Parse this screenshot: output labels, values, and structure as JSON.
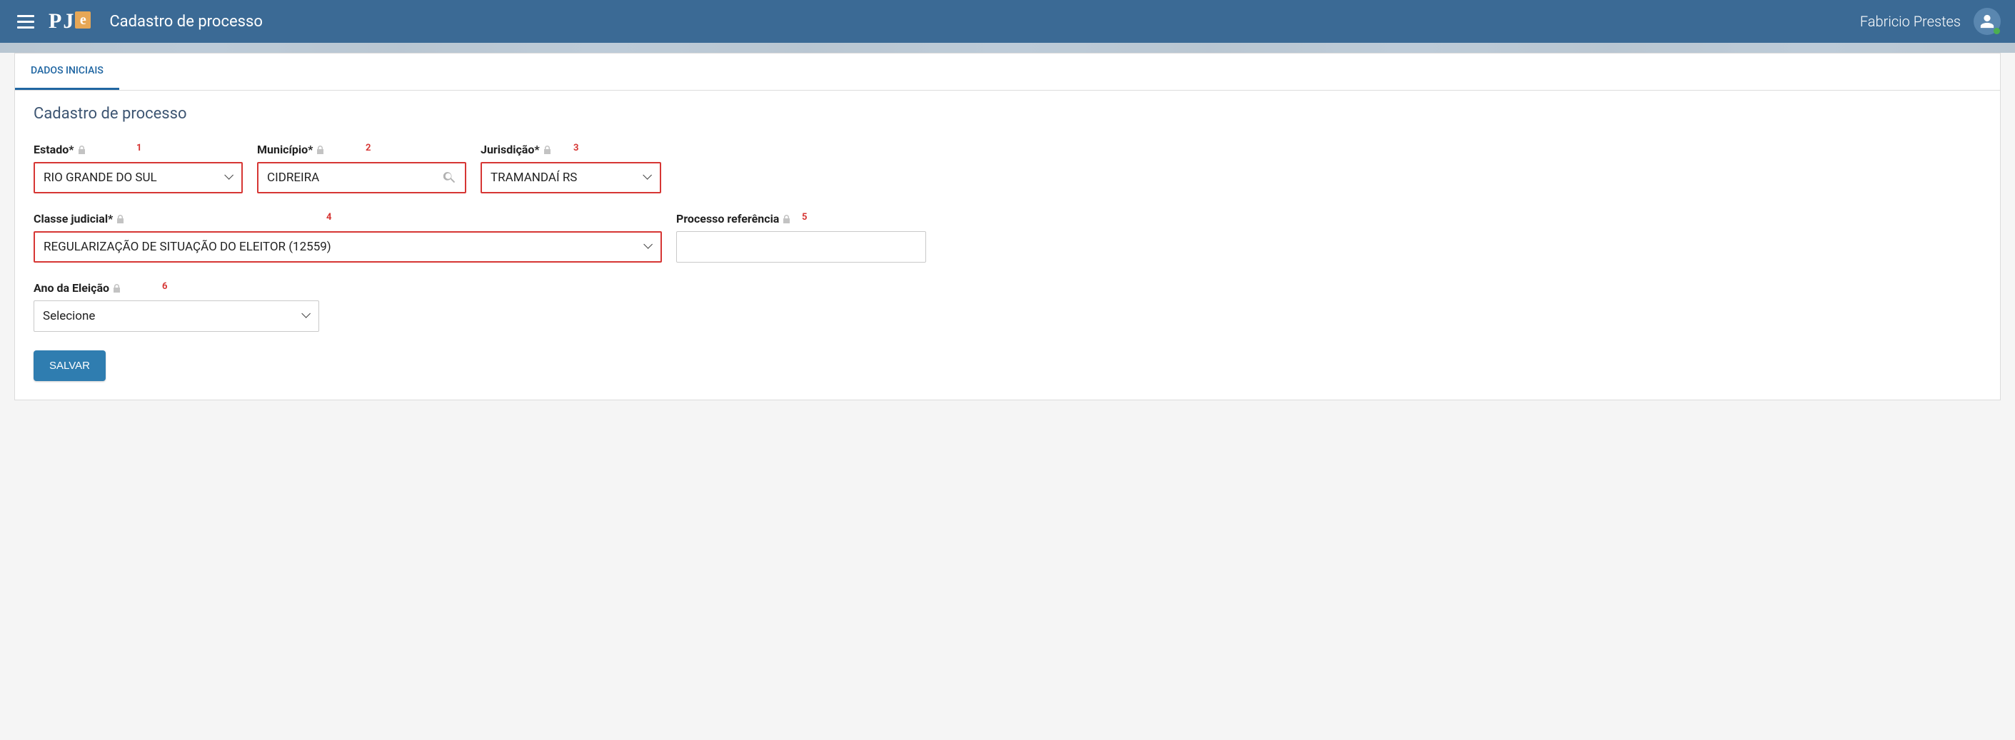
{
  "header": {
    "page_title": "Cadastro de processo",
    "user_name": "Fabricio Prestes",
    "logo_text": {
      "p": "P",
      "j": "J",
      "e": "e"
    }
  },
  "tabs": {
    "initial_data": "DADOS INICIAIS"
  },
  "form": {
    "title": "Cadastro de processo",
    "estado": {
      "label": "Estado*",
      "value": "RIO GRANDE DO SUL",
      "annotation": "1"
    },
    "municipio": {
      "label": "Município*",
      "value": "CIDREIRA",
      "annotation": "2"
    },
    "jurisdicao": {
      "label": "Jurisdição*",
      "value": "TRAMANDAÍ RS",
      "annotation": "3"
    },
    "classe": {
      "label": "Classe judicial*",
      "value": "REGULARIZAÇÃO DE SITUAÇÃO DO ELEITOR (12559)",
      "annotation": "4"
    },
    "processo_ref": {
      "label": "Processo referência",
      "value": "",
      "annotation": "5"
    },
    "ano_eleicao": {
      "label": "Ano da Eleição",
      "value": "Selecione",
      "annotation": "6"
    },
    "save_label": "SALVAR"
  }
}
